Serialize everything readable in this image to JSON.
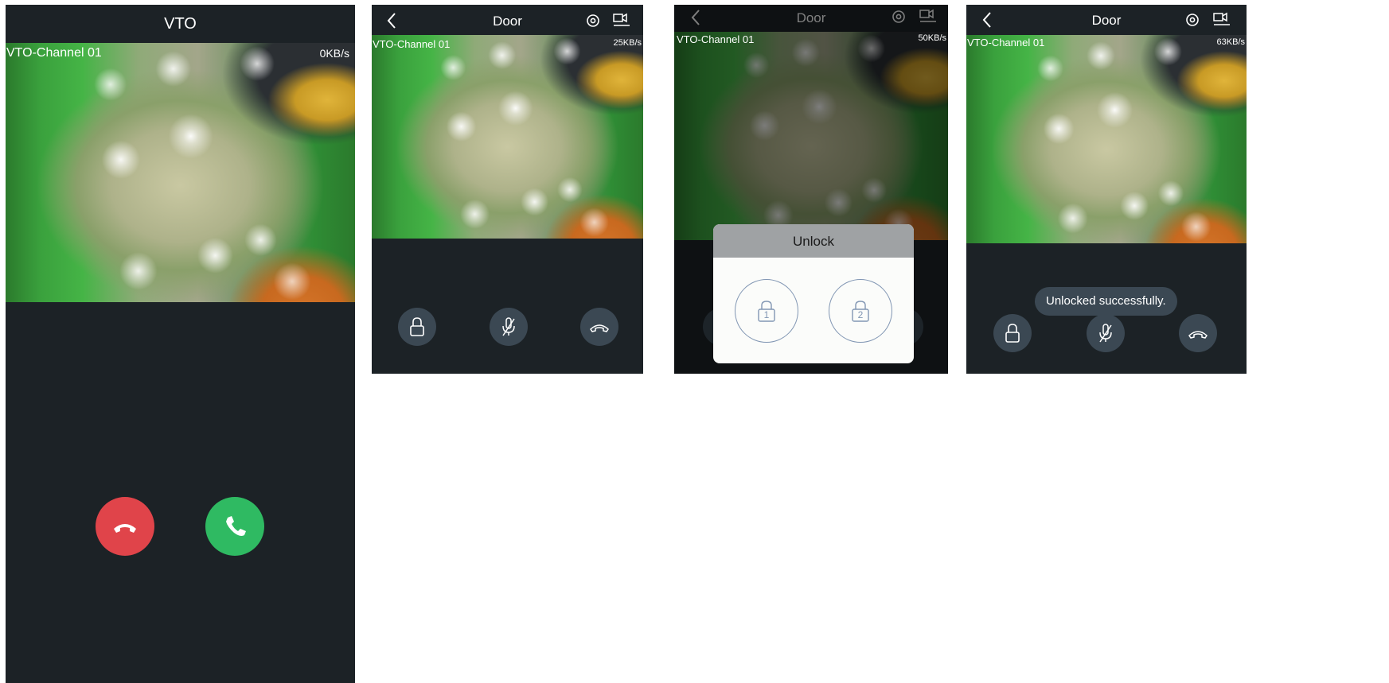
{
  "screen1": {
    "title": "VTO",
    "channel_label": "VTO-Channel 01",
    "speed": "0KB/s",
    "reject_button_color": "#e0444a",
    "answer_button_color": "#2fba62"
  },
  "screen2": {
    "title": "Door",
    "channel_label": "VTO-Channel 01",
    "speed": "25KB/s"
  },
  "screen3": {
    "title": "Door",
    "channel_label": "VTO-Channel 01",
    "speed": "50KB/s",
    "dialog": {
      "title": "Unlock",
      "lock_1_label": "1",
      "lock_2_label": "2"
    }
  },
  "screen4": {
    "title": "Door",
    "channel_label": "VTO-Channel 01",
    "speed": "63KB/s",
    "toast": "Unlocked successfully."
  },
  "icons": {
    "back": "chevron-left-icon",
    "settings": "settings-icon",
    "record": "record-icon",
    "unlock": "lock-icon",
    "mute": "microphone-off-icon",
    "hangup": "hang-up-icon"
  }
}
